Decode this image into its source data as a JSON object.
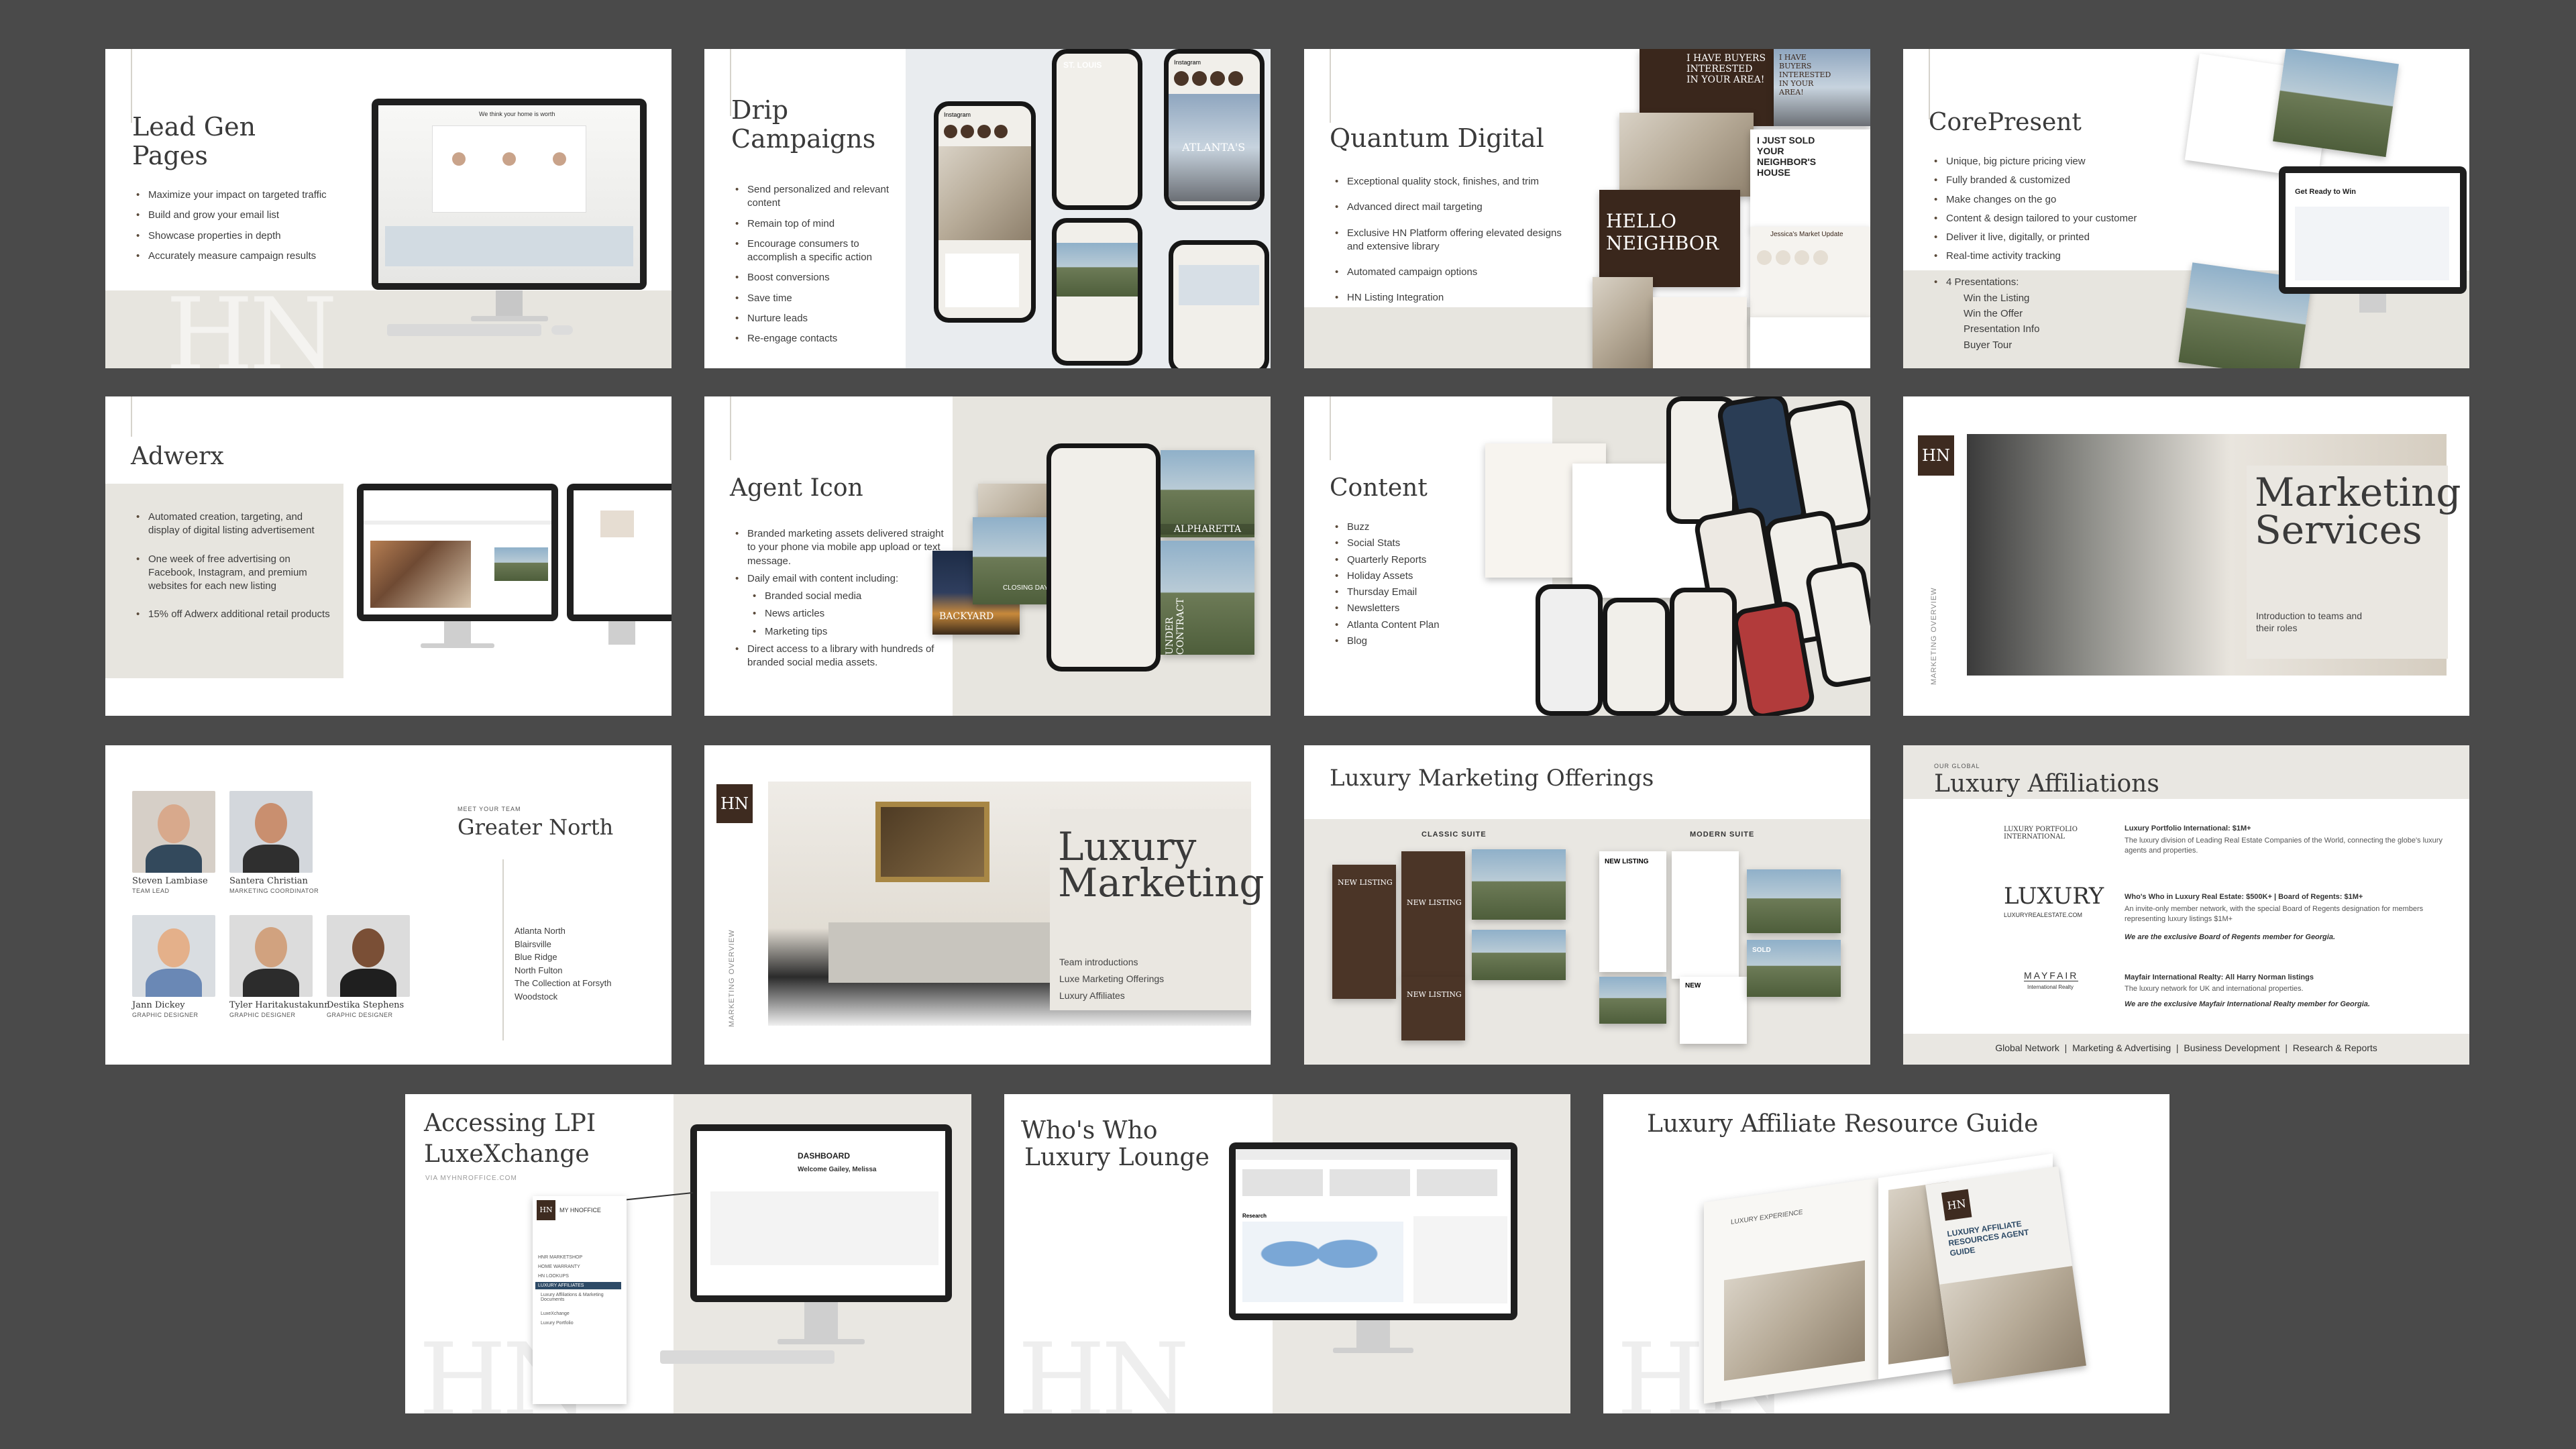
{
  "slides": {
    "lead_gen": {
      "title": "Lead Gen Pages",
      "bullets": [
        "Maximize your impact on targeted traffic",
        "Build and grow your email list",
        "Showcase properties in depth",
        "Accurately measure campaign results"
      ],
      "screen_heading": "We think your home is worth"
    },
    "drip": {
      "title": "Drip Campaigns",
      "bullets": [
        "Send personalized and relevant content",
        "Remain top of mind",
        "Encourage consumers to accomplish a specific action",
        "Boost conversions",
        "Save time",
        "Nurture leads",
        "Re-engage contacts"
      ],
      "phone_texts": [
        "ST. LOUIS",
        "ATLANTA'S",
        "Instagram",
        "Instagram"
      ]
    },
    "quantum": {
      "title": "Quantum Digital",
      "bullets": [
        "Exceptional quality stock, finishes, and trim",
        "Advanced direct mail targeting",
        "Exclusive HN Platform offering elevated designs and extensive library",
        "Automated campaign options",
        "HN Listing Integration"
      ],
      "card_texts": [
        "I HAVE BUYERS INTERESTED IN YOUR AREA!",
        "I HAVE BUYERS INTERESTED IN YOUR AREA!",
        "I JUST SOLD YOUR NEIGHBOR'S HOUSE",
        "HELLO NEIGHBOR",
        "Jessica's Market Update"
      ]
    },
    "corepresent": {
      "title": "CorePresent",
      "bullets": [
        "Unique, big picture pricing view",
        "Fully branded & customized",
        "Make changes on the go",
        "Content & design tailored to your customer",
        "Deliver it live, digitally, or printed",
        "Real-time activity tracking"
      ],
      "presentations_label": "4 Presentations:",
      "presentations": [
        "Win the Listing",
        "Win the Offer",
        "Presentation Info",
        "Buyer Tour"
      ],
      "screen_heading": "Get Ready to Win"
    },
    "adwerx": {
      "title": "Adwerx",
      "bullets": [
        "Automated creation, targeting, and display of digital listing advertisement",
        "One week of free advertising on Facebook, Instagram, and premium websites for each new listing",
        "15% off Adwerx additional retail products"
      ]
    },
    "agent_icon": {
      "title": "Agent Icon",
      "bullets": [
        "Branded marketing assets delivered straight to your phone via mobile app upload or text message.",
        "Daily email with content including:"
      ],
      "sub_bullets": [
        "Branded social media",
        "News articles",
        "Marketing tips"
      ],
      "bullets2": [
        "Direct access to a library with hundreds of branded social media assets."
      ],
      "card_texts": [
        "ALPHARETTA",
        "BACKYARD",
        "UNDER CONTRACT",
        "CLOSING DAY"
      ]
    },
    "content": {
      "title": "Content",
      "bullets": [
        "Buzz",
        "Social Stats",
        "Quarterly Reports",
        "Holiday Assets",
        "Thursday Email",
        "Newsletters",
        "Atlanta Content Plan",
        "Blog"
      ]
    },
    "marketing_services": {
      "title_line1": "Marketing",
      "title_line2": "Services",
      "subtitle": "Introduction to teams and their roles",
      "side_label": "MARKETING OVERVIEW"
    },
    "team": {
      "eyebrow": "MEET YOUR TEAM",
      "title": "Greater North",
      "members": [
        {
          "name": "Steven Lambiase",
          "role": "TEAM LEAD"
        },
        {
          "name": "Santera Christian",
          "role": "MARKETING COORDINATOR"
        },
        {
          "name": "Jann Dickey",
          "role": "GRAPHIC DESIGNER"
        },
        {
          "name": "Tyler Haritakustakunn",
          "role": "GRAPHIC DESIGNER"
        },
        {
          "name": "Destika Stephens",
          "role": "GRAPHIC DESIGNER"
        }
      ],
      "offices": [
        "Atlanta North",
        "Blairsville",
        "Blue Ridge",
        "North Fulton",
        "The Collection at Forsyth",
        "Woodstock"
      ]
    },
    "luxury_marketing": {
      "title_line1": "Luxury",
      "title_line2": "Marketing",
      "items": [
        "Team introductions",
        "Luxe Marketing Offerings",
        "Luxury Affiliates"
      ],
      "side_label": "MARKETING OVERVIEW"
    },
    "offerings": {
      "title": "Luxury Marketing Offerings",
      "classic_label": "CLASSIC SUITE",
      "modern_label": "MODERN SUITE",
      "card_texts": [
        "NEW LISTING",
        "NEW LISTING",
        "NEW LISTING",
        "NEW LISTING",
        "NEW",
        "SOLD"
      ]
    },
    "affiliations": {
      "eyebrow": "OUR GLOBAL",
      "title": "Luxury Affiliations",
      "items": [
        {
          "logo": "LUXURY PORTFOLIO INTERNATIONAL",
          "heading": "Luxury Portfolio International: $1M+",
          "body": "The luxury division of Leading Real Estate Companies of the World, connecting the globe's luxury agents and properties.",
          "note": ""
        },
        {
          "logo": "LUXURY",
          "logo_sub": "LUXURYREALESTATE.COM",
          "heading": "Who's Who in Luxury Real Estate: $500K+ | Board of Regents: $1M+",
          "body": "An invite-only member network, with the special Board of Regents designation for members representing luxury listings $1M+",
          "note": "We are the exclusive Board of Regents member for Georgia."
        },
        {
          "logo": "MAYFAIR",
          "logo_sub": "International Realty",
          "heading": "Mayfair International Realty: All Harry Norman listings",
          "body": "The luxury network for UK and international properties.",
          "note": "We are the exclusive Mayfair International Realty member for Georgia."
        }
      ],
      "footer": "Global Network  |  Marketing & Advertising  |  Business Development  |  Research & Reports"
    },
    "accessing": {
      "title_line1": "Accessing LPI",
      "title_line2": "LuxeXchange",
      "subtitle": "VIA MYHNROFFICE.COM",
      "dashboard": "DASHBOARD",
      "welcome": "Welcome Gailey, Melissa",
      "menu_brand": "MY HNOFFICE",
      "menu_items": [
        "HNR MARKETSHOP",
        "HOME WARRANTY",
        "HN LOOKUPS",
        "LUXURY AFFILIATES",
        "Luxury Affiliations & Marketing Documents",
        "LuxeXchange",
        "Luxury Portfolio"
      ]
    },
    "whos_who": {
      "title_line1": "Who's Who",
      "title_line2": "Luxury Lounge",
      "screen_label": "Research"
    },
    "resource_guide": {
      "title": "Luxury Affiliate Resource Guide",
      "book_text1": "LUXURY EXPERIENCE",
      "book_text2": "LUXURY AFFILIATE RESOURCES AGENT GUIDE"
    }
  },
  "watermark": "HN",
  "logo": "HN",
  "colors": {
    "background": "#4a4a4a",
    "slide": "#ffffff",
    "panel": "#e7e5df",
    "brand_brown": "#3e2b20",
    "text": "#3a3a3a"
  }
}
